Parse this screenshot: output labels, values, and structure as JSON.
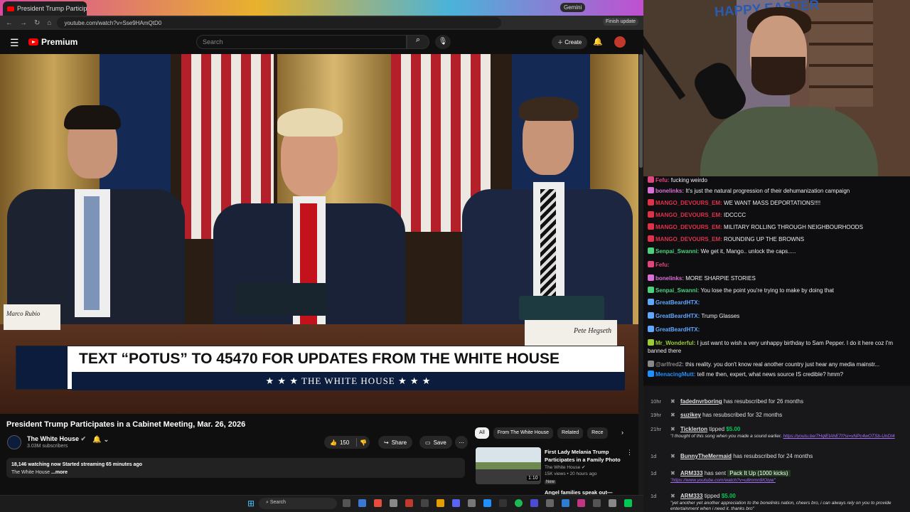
{
  "browser": {
    "tab_title": "President Trump Participat",
    "gemini_label": "Gemini",
    "url": "youtube.com/watch?v=Sse9HAmQtD0",
    "finish_update": "Finish update"
  },
  "youtube_header": {
    "logo_text": "Premium",
    "search_placeholder": "Search",
    "create_label": "Create"
  },
  "video": {
    "banner_text": "TEXT “POTUS” TO 45470 FOR UPDATES FROM THE WHITE HOUSE",
    "banner_strip": "★ ★ ★  THE WHITE HOUSE  ★ ★ ★",
    "nameplate_left": "Marco Rubio",
    "nameplate_right": "Pete Hegseth"
  },
  "info": {
    "title": "President Trump Participates in a Cabinet Meeting, Mar. 26, 2026",
    "channel": "The White House",
    "subscribers": "3.03M subscribers",
    "likes": "150",
    "share": "Share",
    "save": "Save",
    "watching": "18,146 watching now  Started streaming 65 minutes ago",
    "desc_line2": "The White House",
    "more": "...more"
  },
  "recs": {
    "chips": [
      "All",
      "From The White House",
      "Related",
      "Rece"
    ],
    "title": "First Lady Melania Trump Participates in a Family Photo",
    "channel": "The White House",
    "meta": "15K views • 20 hours ago",
    "badge": "New",
    "duration": "1:10",
    "next_title": "Angel families speak out—"
  },
  "chat": [
    {
      "user": "Fefu:",
      "text": "fucking weirdo",
      "color": "#e0457b"
    },
    {
      "user": "bonelinks:",
      "text": "It's just the natural progression of their dehumanization campaign",
      "color": "#da70d6"
    },
    {
      "user": "MANGO_DEVOURS_EM:",
      "text": "WE WANT MASS DEPORTATIONS!!!!",
      "color": "#e0304a"
    },
    {
      "user": "MANGO_DEVOURS_EM:",
      "text": "IDCCCC",
      "color": "#e0304a"
    },
    {
      "user": "MANGO_DEVOURS_EM:",
      "text": "MILITARY ROLLING THROUGH NEIGHBOURHOODS",
      "color": "#e0304a"
    },
    {
      "user": "MANGO_DEVOURS_EM:",
      "text": "ROUNDING UP THE BROWNS",
      "color": "#e0304a"
    },
    {
      "user": "Senpai_Swanni:",
      "text": "We get it, Mango.. unlock the caps.....",
      "color": "#4cd07d"
    },
    {
      "user": "Fefu:",
      "text": "",
      "color": "#e0457b"
    },
    {
      "user": "bonelinks:",
      "text": "MORE SHARPIE STORIES",
      "color": "#da70d6"
    },
    {
      "user": "Senpai_Swanni:",
      "text": "You lose the point you're trying to make by doing that",
      "color": "#4cd07d"
    },
    {
      "user": "GreatBeardHTX:",
      "text": "",
      "color": "#5fa8ff"
    },
    {
      "user": "GreatBeardHTX:",
      "text": "Trump Glasses",
      "color": "#5fa8ff"
    },
    {
      "user": "GreatBeardHTX:",
      "text": "",
      "color": "#5fa8ff"
    },
    {
      "user": "Mr_Wonderful:",
      "text": "I just want to wish a very unhappy birthday to Sam Pepper. I do it here coz I'm banned there",
      "color": "#9acd32"
    },
    {
      "user": "@arlfred2:",
      "text": "this reality. you don't know real another country just hear any media mainstr...",
      "color": "#888888"
    },
    {
      "user": "MenacingMutt:",
      "text": "tell me then, expert, what news source IS credible? hmm?",
      "color": "#1e90ff"
    }
  ],
  "events": [
    {
      "time": "10hr",
      "name": "fadednvrboring",
      "text": "has resubscribed for 26 months"
    },
    {
      "time": "19hr",
      "name": "suzikey",
      "text": "has resubscribed for 32 months"
    },
    {
      "time": "21hr",
      "name": "Ticklerton",
      "text": "tipped",
      "amount": "$5.00",
      "sub": "\"I thought of this song when you made a sound earlier.",
      "link": "https://youtu.be/7HqlEtAhE7I?si=vNPc4wOTSb-UnDI4"
    },
    {
      "time": "1d",
      "name": "BunnyTheMermaid",
      "text": "has resubscribed for 24 months"
    },
    {
      "time": "1d",
      "name": "ARM333",
      "text": "has sent",
      "gift": "Pack It Up (1000 kicks)",
      "link": "\"https://www.youtube.com/watch?v=u8mmn9IOiyw\""
    },
    {
      "time": "1d",
      "name": "ARM333",
      "text": "tipped",
      "amount": "$5.00",
      "sub": "\"yet another yet another appreciation to the bonelinks nation, cheers bro, i can always rely on you to provide entertainment when i need it. thanks bro\""
    }
  ],
  "taskbar": {
    "search": "Search"
  },
  "colors": {
    "youtube_red": "#ff0000",
    "banner_navy": "#0c1c3c",
    "tip_green": "#00c853",
    "twitch_link": "#a970ff"
  },
  "cam": {
    "banner": "HAPPY EASTER"
  }
}
